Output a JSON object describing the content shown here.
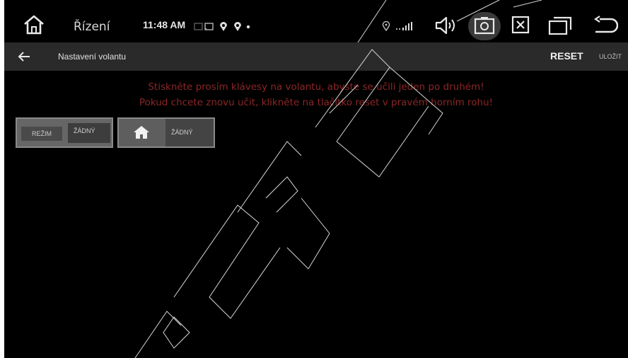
{
  "statusbar": {
    "title": "Řízení",
    "time": "11:48 AM",
    "icons": [
      "home-icon",
      "cast-icon",
      "notification-icon",
      "notification-icon",
      "dot-icon",
      "location-icon",
      "signal-icon",
      "volume-icon",
      "screenshot-icon",
      "close-icon",
      "recents-icon",
      "back-icon"
    ]
  },
  "appbar": {
    "title": "Nastavení volantu",
    "reset_label": "RESET",
    "save_label": "ULOŽIT"
  },
  "instructions": {
    "line1": "Stiskněte prosím klávesy na volantu, abyste se učili jeden po druhém!",
    "line2": "Pokud chcete znovu učit, klikněte na tlačítko reset v pravém horním rohu!"
  },
  "keys": [
    {
      "label": "REŽIM",
      "value": "ŽÁDNÝ"
    },
    {
      "icon": "home-icon",
      "value": "ŽÁDNÝ"
    }
  ],
  "colors": {
    "background": "#000000",
    "appbar": "#2a2a2a",
    "instruction_text": "#8b2626"
  }
}
